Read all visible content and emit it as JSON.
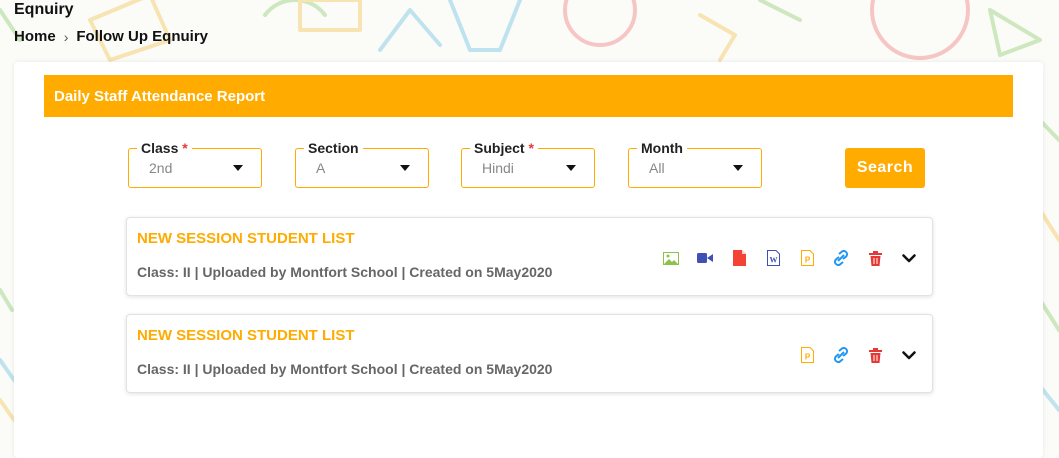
{
  "page": {
    "title": "Eqnuiry",
    "breadcrumb": [
      "Home",
      "Follow Up Eqnuiry"
    ]
  },
  "report": {
    "header": "Daily Staff Attendance Report"
  },
  "filters": [
    {
      "label": "Class",
      "required": true,
      "value": "2nd"
    },
    {
      "label": "Section",
      "required": false,
      "value": "A"
    },
    {
      "label": "Subject",
      "required": true,
      "value": "Hindi"
    },
    {
      "label": "Month",
      "required": false,
      "value": "All"
    }
  ],
  "search_label": "Search",
  "items": [
    {
      "title": "NEW SESSION STUDENT LIST",
      "meta": "Class: II | Uploaded by Montfort School | Created on 5May2020",
      "actions": [
        "image-icon",
        "video-icon",
        "pdf-icon",
        "word-icon",
        "ppt-icon",
        "link-icon",
        "delete-icon",
        "chevron-down-icon"
      ]
    },
    {
      "title": "NEW SESSION STUDENT LIST",
      "meta": "Class: II | Uploaded by Montfort School | Created on 5May2020",
      "actions": [
        "ppt-icon",
        "link-icon",
        "delete-icon",
        "chevron-down-icon"
      ]
    }
  ],
  "colors": {
    "accent": "#ffab00",
    "required": "#e53935",
    "image_icon": "#8bc34a",
    "video_icon": "#3f51b5",
    "pdf_icon": "#f44336",
    "word_icon": "#3f51b5",
    "ppt_icon": "#ffab00",
    "link_icon": "#2196f3",
    "delete_icon": "#e53935"
  }
}
